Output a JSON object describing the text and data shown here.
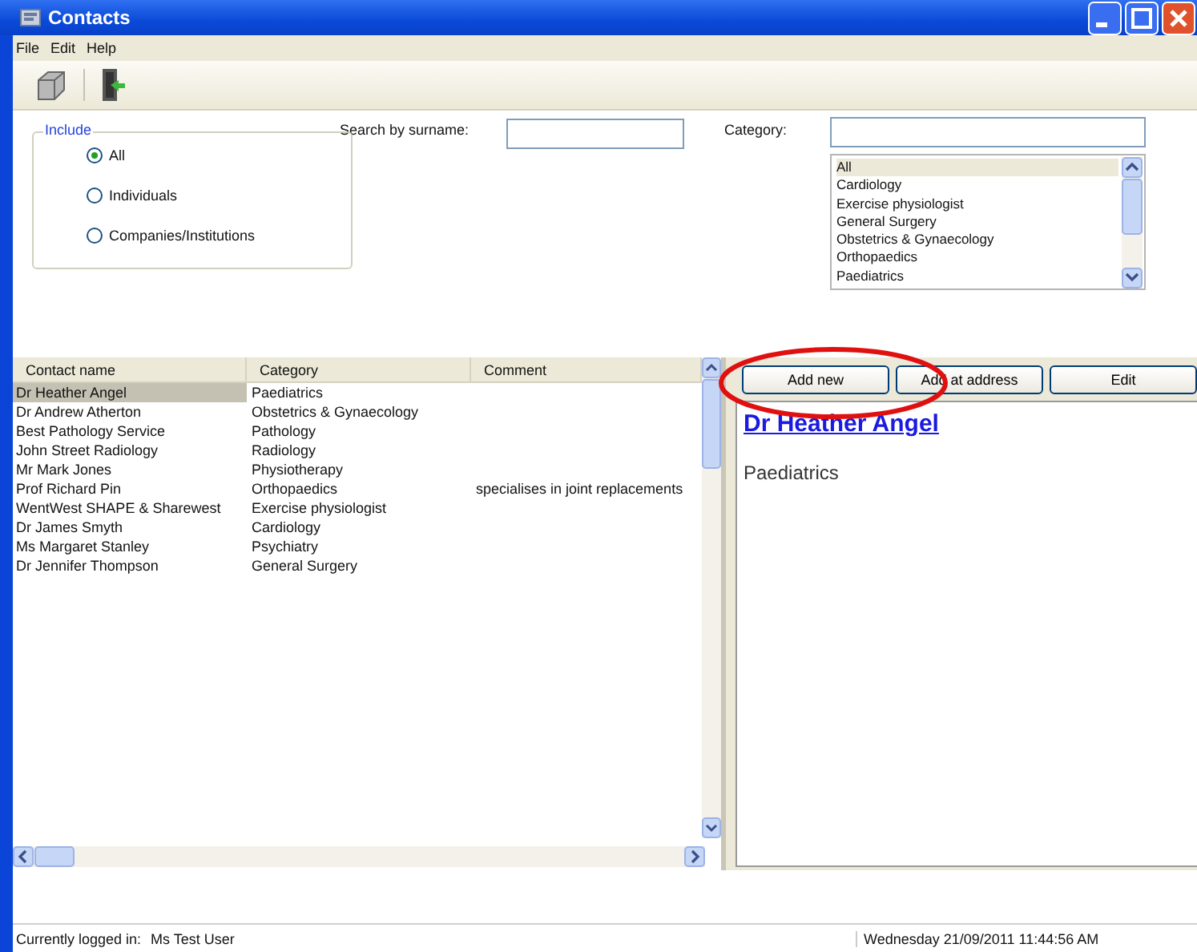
{
  "window": {
    "title": "Contacts"
  },
  "menu": [
    "File",
    "Edit",
    "Help"
  ],
  "include": {
    "label": "Include",
    "options": [
      {
        "label": "All",
        "selected": true
      },
      {
        "label": "Individuals",
        "selected": false
      },
      {
        "label": "Companies/Institutions",
        "selected": false
      }
    ]
  },
  "search": {
    "label": "Search by surname:"
  },
  "category": {
    "label": "Category:",
    "items": [
      {
        "label": "All",
        "selected": true
      },
      {
        "label": "Cardiology",
        "selected": false
      },
      {
        "label": "Exercise physiologist",
        "selected": false
      },
      {
        "label": "General Surgery",
        "selected": false
      },
      {
        "label": "Obstetrics & Gynaecology",
        "selected": false
      },
      {
        "label": "Orthopaedics",
        "selected": false
      },
      {
        "label": "Paediatrics",
        "selected": false
      }
    ]
  },
  "table": {
    "columns": [
      "Contact name",
      "Category",
      "Comment"
    ],
    "rows": [
      {
        "cells": [
          "Dr Heather Angel",
          "Paediatrics",
          ""
        ],
        "selected": true
      },
      {
        "cells": [
          "Dr Andrew Atherton",
          "Obstetrics & Gynaecology",
          ""
        ],
        "selected": false
      },
      {
        "cells": [
          "Best Pathology Service",
          "Pathology",
          ""
        ],
        "selected": false
      },
      {
        "cells": [
          "John Street Radiology",
          "Radiology",
          ""
        ],
        "selected": false
      },
      {
        "cells": [
          "Mr Mark Jones",
          "Physiotherapy",
          ""
        ],
        "selected": false
      },
      {
        "cells": [
          "Prof Richard Pin",
          "Orthopaedics",
          "specialises in joint replacements"
        ],
        "selected": false
      },
      {
        "cells": [
          "WentWest SHAPE & Sharewest",
          "Exercise physiologist",
          ""
        ],
        "selected": false
      },
      {
        "cells": [
          "Dr James Smyth",
          "Cardiology",
          ""
        ],
        "selected": false
      },
      {
        "cells": [
          "Ms Margaret Stanley",
          "Psychiatry",
          ""
        ],
        "selected": false
      },
      {
        "cells": [
          "Dr Jennifer Thompson",
          "General Surgery",
          ""
        ],
        "selected": false
      }
    ]
  },
  "buttons": [
    "Add new",
    "Add at address",
    "Edit"
  ],
  "detail": {
    "name": "Dr Heather Angel",
    "category": "Paediatrics"
  },
  "status_bar": {
    "user_label": "Currently logged in:",
    "user": "Ms Test User",
    "datetime": "Wednesday 21/09/2011 11:44:56 AM"
  }
}
